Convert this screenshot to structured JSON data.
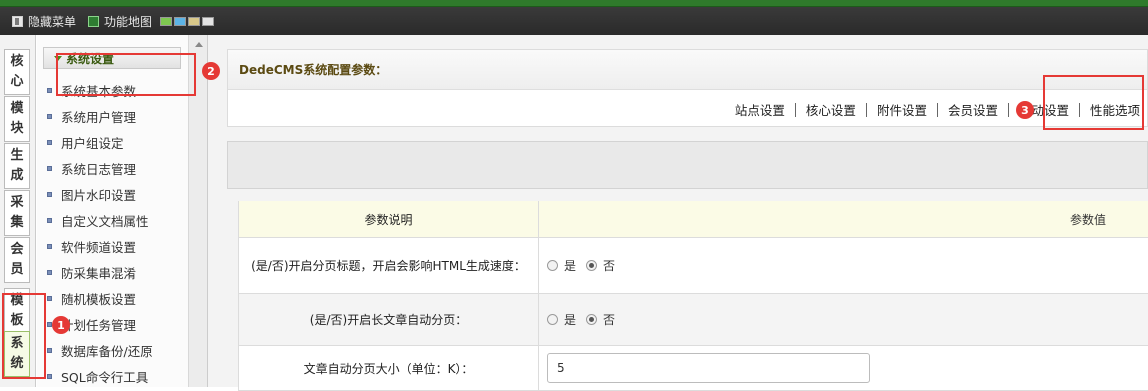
{
  "toolbar": {
    "hide_menu_label": "隐藏菜单",
    "function_map_label": "功能地图",
    "swatch_colors": [
      "#7ec850",
      "#5db4e6",
      "#d8c88a",
      "#e4e4e4"
    ]
  },
  "left_tabs": [
    {
      "c1": "核",
      "c2": "心"
    },
    {
      "c1": "模",
      "c2": "块"
    },
    {
      "c1": "生",
      "c2": "成"
    },
    {
      "c1": "采",
      "c2": "集"
    },
    {
      "c1": "会",
      "c2": "员"
    },
    {
      "c1": "模",
      "c2": "板"
    },
    {
      "c1": "系",
      "c2": "统"
    }
  ],
  "menu": {
    "header": "系统设置",
    "items": [
      "系统基本参数",
      "系统用户管理",
      "用户组设定",
      "系统日志管理",
      "图片水印设置",
      "自定义文档属性",
      "软件频道设置",
      "防采集串混淆",
      "随机模板设置",
      "计划任务管理",
      "数据库备份/还原",
      "SQL命令行工具"
    ]
  },
  "main": {
    "title": "DedeCMS系统配置参数：",
    "tabs": [
      "站点设置",
      "核心设置",
      "附件设置",
      "会员设置",
      "互动设置",
      "性能选项"
    ],
    "table_header": {
      "col1": "参数说明",
      "col2": "参数值"
    },
    "rows": [
      {
        "desc": "(是/否)开启分页标题，开启会影响HTML生成速度：",
        "opt_yes": "是",
        "opt_no": "否",
        "selected": "否"
      },
      {
        "desc": "(是/否)开启长文章自动分页：",
        "opt_yes": "是",
        "opt_no": "否",
        "selected": "否"
      },
      {
        "desc": "文章自动分页大小（单位：K）：",
        "value": "5"
      }
    ]
  },
  "annotations": {
    "badge1": "1",
    "badge2": "2",
    "badge3": "3",
    "highlight_color": "#e53935"
  }
}
